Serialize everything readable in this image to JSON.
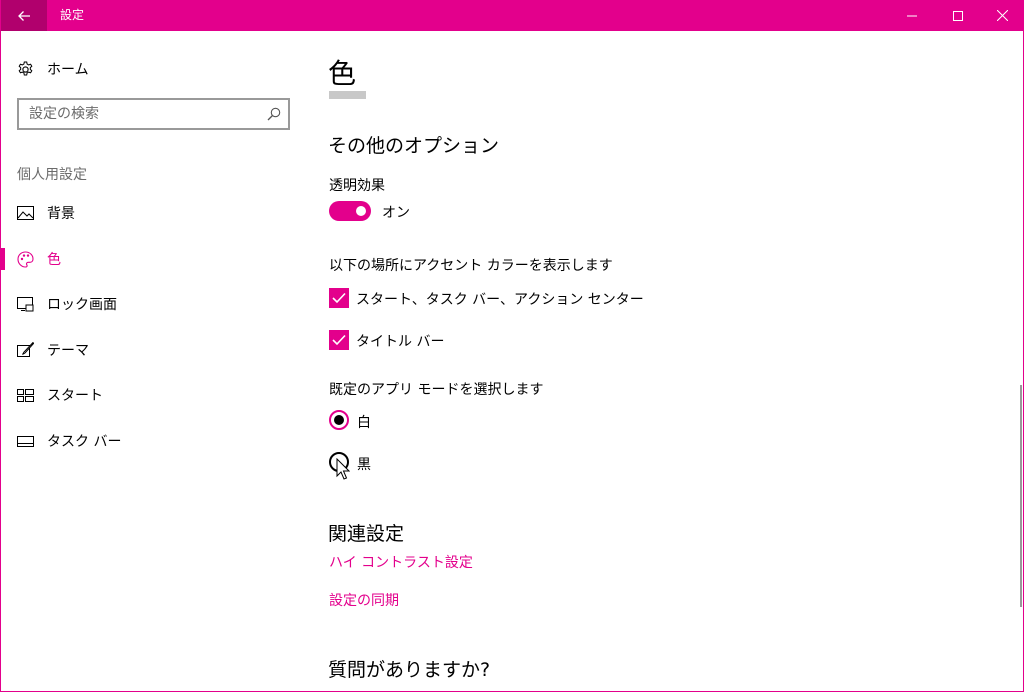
{
  "window": {
    "title": "設定"
  },
  "sidebar": {
    "home_label": "ホーム",
    "search_placeholder": "設定の検索",
    "section_label": "個人用設定",
    "items": [
      {
        "label": "背景",
        "icon": "picture-icon"
      },
      {
        "label": "色",
        "icon": "palette-icon",
        "active": true
      },
      {
        "label": "ロック画面",
        "icon": "lock-screen-icon"
      },
      {
        "label": "テーマ",
        "icon": "theme-brush-icon"
      },
      {
        "label": "スタート",
        "icon": "start-tiles-icon"
      },
      {
        "label": "タスク バー",
        "icon": "taskbar-icon"
      }
    ]
  },
  "main": {
    "page_title": "色",
    "more_options_heading": "その他のオプション",
    "transparency": {
      "label": "透明効果",
      "state_text": "オン",
      "on": true
    },
    "accent_surfaces": {
      "label": "以下の場所にアクセント カラーを表示します",
      "options": [
        {
          "label": "スタート、タスク バー、アクション センター",
          "checked": true
        },
        {
          "label": "タイトル バー",
          "checked": true
        }
      ]
    },
    "app_mode": {
      "label": "既定のアプリ モードを選択します",
      "options": [
        {
          "label": "白",
          "selected": true
        },
        {
          "label": "黒",
          "selected": false
        }
      ]
    },
    "related_heading": "関連設定",
    "related_links": [
      "ハイ コントラスト設定",
      "設定の同期"
    ],
    "questions_heading": "質問がありますか?"
  },
  "colors": {
    "accent": "#e3008c",
    "accent_dark": "#b1006d"
  }
}
